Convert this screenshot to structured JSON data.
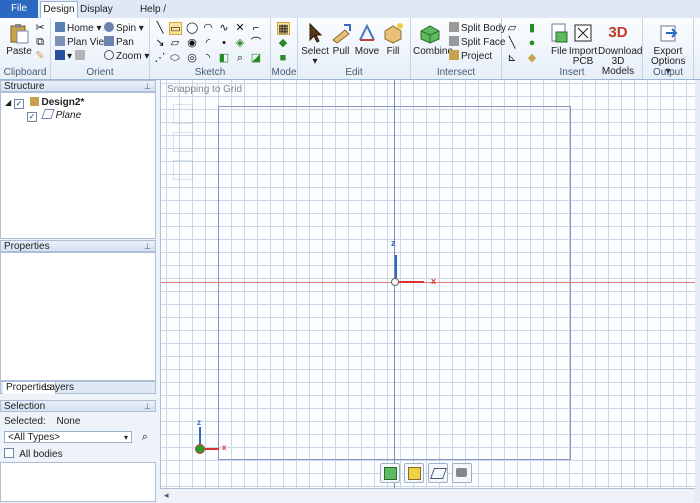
{
  "tabs": {
    "file": "File",
    "design": "Design",
    "display": "Display",
    "help": "Help / Resources"
  },
  "clipboard": {
    "paste": "Paste",
    "group": "Clipboard"
  },
  "orient": {
    "home": "Home",
    "plan_view": "Plan View",
    "spin": "Spin",
    "pan": "Pan",
    "zoom": "Zoom",
    "group": "Orient"
  },
  "sketch": {
    "group": "Sketch"
  },
  "mode": {
    "group": "Mode"
  },
  "edit": {
    "select": "Select",
    "pull": "Pull",
    "move": "Move",
    "fill": "Fill",
    "group": "Edit"
  },
  "intersect": {
    "combine": "Combine",
    "split_body": "Split Body",
    "split_face": "Split Face",
    "project": "Project",
    "group": "Intersect"
  },
  "insert": {
    "file": "File",
    "import_pcb": "Import PCB",
    "download_3d": "Download 3D Models",
    "group": "Insert",
    "badge_3d": "3D"
  },
  "output": {
    "export_options": "Export Options",
    "group": "Output"
  },
  "structure": {
    "title": "Structure",
    "design_name": "Design2*",
    "plane": "Plane"
  },
  "properties": {
    "title": "Properties",
    "tab_properties": "Properties",
    "tab_layers": "Layers"
  },
  "selection": {
    "title": "Selection",
    "selected_label": "Selected:",
    "selected_value": "None",
    "type_filter": "<All Types>",
    "all_bodies": "All bodies"
  },
  "canvas": {
    "snapping": "Snapping to Grid",
    "axis_z": "z",
    "axis_x": "x"
  },
  "colors": {
    "accent": "#2b68c1",
    "axis_x": "#e03030",
    "axis_z": "#2b68c1",
    "plane_border": "#8a93c9"
  }
}
